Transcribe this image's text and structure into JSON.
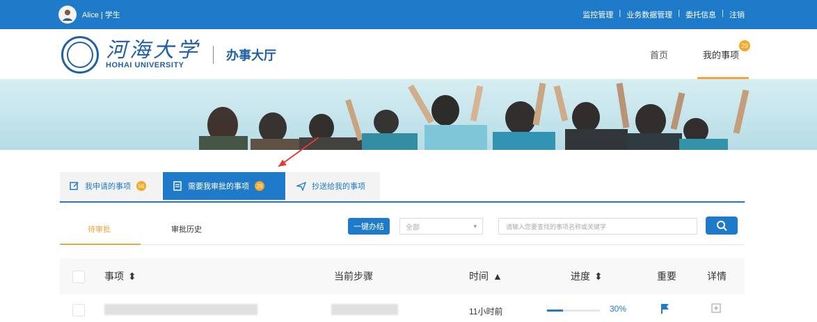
{
  "topbar": {
    "user_label": "Alice | 学生",
    "links": [
      "监控管理",
      "业务数据管理",
      "委托信息",
      "注销"
    ]
  },
  "header": {
    "university_cn": "河海大学",
    "university_en": "HOHAI UNIVERSITY",
    "app_title": "办事大厅",
    "nav": [
      {
        "label": "首页"
      },
      {
        "label": "我的事项",
        "badge": "29"
      }
    ]
  },
  "tabs": [
    {
      "label": "我申请的事项",
      "badge": "66"
    },
    {
      "label": "需要我审批的事项",
      "badge": "29"
    },
    {
      "label": "抄送给我的事项"
    }
  ],
  "subtabs": [
    {
      "label": "待审批"
    },
    {
      "label": "审批历史"
    }
  ],
  "toolbar": {
    "one_click": "一键办结",
    "select_value": "全部",
    "search_placeholder": "请输入您要查找的事项名称或关键字"
  },
  "table": {
    "columns": [
      "事项",
      "当前步骤",
      "时间",
      "进度",
      "重要",
      "详情"
    ],
    "row": {
      "time": "11小时前",
      "progress": 30,
      "progress_text": "30%"
    }
  },
  "colors": {
    "primary": "#1f7bc9",
    "accent": "#f0a43a"
  }
}
